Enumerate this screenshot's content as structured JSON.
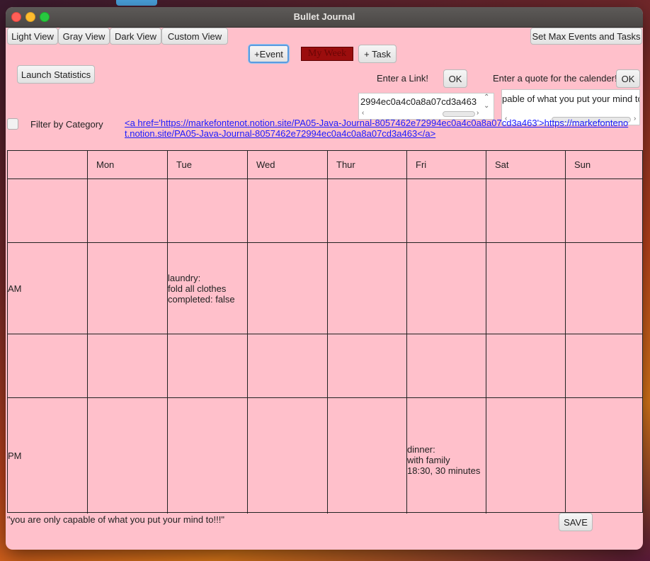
{
  "window": {
    "title": "Bullet Journal"
  },
  "toolbar": {
    "light_view": "Light View",
    "gray_view": "Gray View",
    "dark_view": "Dark View",
    "custom_view": "Custom View",
    "set_max": "Set Max Events and Tasks",
    "add_event": "+Event",
    "week_name": "My Week",
    "add_task": "+ Task",
    "launch_statistics": "Launch Statistics"
  },
  "link_section": {
    "prompt": "Enter a Link!",
    "ok": "OK",
    "input_value": "2994ec0a4c0a8a07cd3a463"
  },
  "quote_section": {
    "prompt": "Enter a quote for the calender!",
    "ok": "OK",
    "input_value": "pable of what you put your mind to!!!"
  },
  "filter": {
    "label": "Filter by Category",
    "checked": false
  },
  "link_html": "<a href='https://markefontenot.notion.site/PA05-Java-Journal-8057462e72994ec0a4c0a8a07cd3a463'>https://markefontenot.notion.site/PA05-Java-Journal-8057462e72994ec0a4c0a8a07cd3a463</a>",
  "calendar": {
    "days": [
      "",
      "Mon",
      "Tue",
      "Wed",
      "Thur",
      "Fri",
      "Sat",
      "Sun"
    ],
    "rows": [
      {
        "label": "",
        "cells": [
          "",
          "",
          "",
          "",
          "",
          "",
          ""
        ]
      },
      {
        "label": "AM",
        "cells": [
          "",
          "laundry:\nfold all clothes\ncompleted: false",
          "",
          "",
          "",
          "",
          ""
        ]
      },
      {
        "label": "",
        "cells": [
          "",
          "",
          "",
          "",
          "",
          "",
          ""
        ]
      },
      {
        "label": "PM",
        "cells": [
          "",
          "",
          "",
          "",
          "dinner:\nwith family\n18:30, 30 minutes",
          "",
          ""
        ]
      }
    ]
  },
  "footer": {
    "quote": "\"you are only capable of what you put your mind to!!!\"",
    "save": "SAVE"
  },
  "colors": {
    "background": "#ffc0cb",
    "week_badge": "#9b0d0d",
    "link": "#1a1aff"
  }
}
